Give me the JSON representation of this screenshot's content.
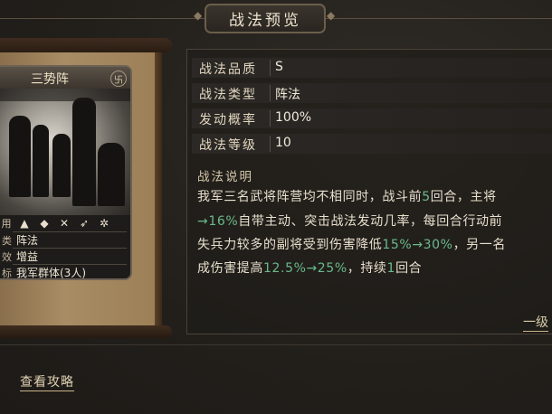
{
  "header": {
    "title": "战法预览"
  },
  "card": {
    "name": "三势阵",
    "seal": "卐",
    "icon_row_label": "用",
    "icons": [
      "cavalry-icon",
      "shield-icon",
      "archer-icon",
      "spear-icon",
      "siege-icon"
    ],
    "rows": [
      {
        "label": "类",
        "value": "阵法"
      },
      {
        "label": "效",
        "value": "增益"
      },
      {
        "label": "标",
        "value": "我军群体(3人)"
      }
    ]
  },
  "stats": [
    {
      "label": "战法品质",
      "value": "S"
    },
    {
      "label": "战法类型",
      "value": "阵法"
    },
    {
      "label": "发动概率",
      "value": "100%"
    },
    {
      "label": "战法等级",
      "value": "10"
    }
  ],
  "description": {
    "heading": "战法说明",
    "lines": [
      [
        {
          "t": "我军三名武将阵营均不相同时，战斗前"
        },
        {
          "t": "5",
          "g": true
        },
        {
          "t": "回合，主将"
        }
      ],
      [
        {
          "t": "→16%",
          "g": true
        },
        {
          "t": "自带主动、突击战法发动几率，每回合行动前"
        }
      ],
      [
        {
          "t": "失兵力较多的副将受到伤害降低"
        },
        {
          "t": "15%→30%",
          "g": true
        },
        {
          "t": "，另一名"
        }
      ],
      [
        {
          "t": "成伤害提高"
        },
        {
          "t": "12.5%→25%",
          "g": true
        },
        {
          "t": "，持续"
        },
        {
          "t": "1",
          "g": true
        },
        {
          "t": "回合"
        }
      ]
    ]
  },
  "links": {
    "level": "一级",
    "guide": "查看攻略"
  },
  "colors": {
    "highlight_green": "#6ab98a",
    "panel_bg": "#26221e",
    "scroll": "#a88c64"
  }
}
